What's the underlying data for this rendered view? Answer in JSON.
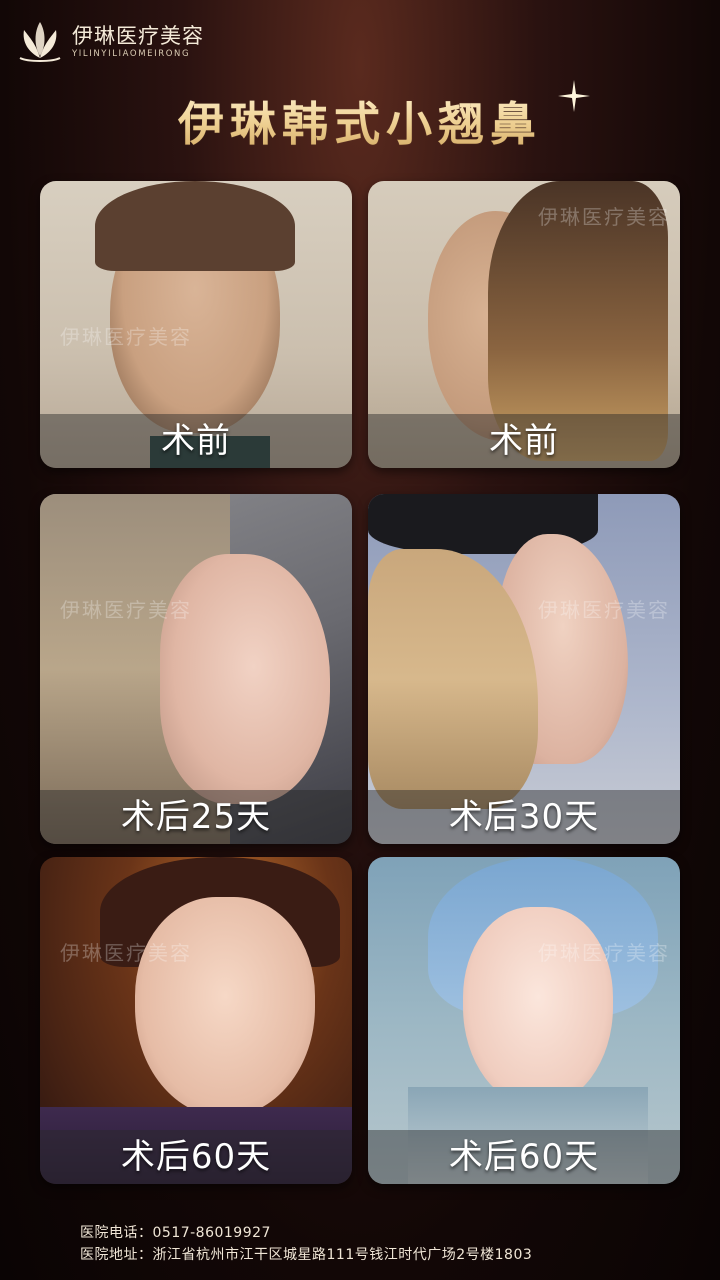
{
  "brand": {
    "name_cn": "伊琳医疗美容",
    "name_en": "YILINYILIAOMEIRONG",
    "logo_icon": "lotus-icon",
    "accent": "#e9c98a"
  },
  "title": "伊琳韩式小翘鼻",
  "cards": [
    {
      "caption": "术前",
      "watermark": "伊琳医疗美容"
    },
    {
      "caption": "术前",
      "watermark": "伊琳医疗美容"
    },
    {
      "caption": "术后25天",
      "watermark": "伊琳医疗美容"
    },
    {
      "caption": "术后30天",
      "watermark": "伊琳医疗美容"
    },
    {
      "caption": "术后60天",
      "watermark": "伊琳医疗美容"
    },
    {
      "caption": "术后60天",
      "watermark": "伊琳医疗美容"
    }
  ],
  "footer": {
    "phone_label": "医院电话：",
    "phone": "0517-86019927",
    "address_label": "医院地址：",
    "address": "浙江省杭州市江干区城星路111号钱江时代广场2号楼1803"
  }
}
